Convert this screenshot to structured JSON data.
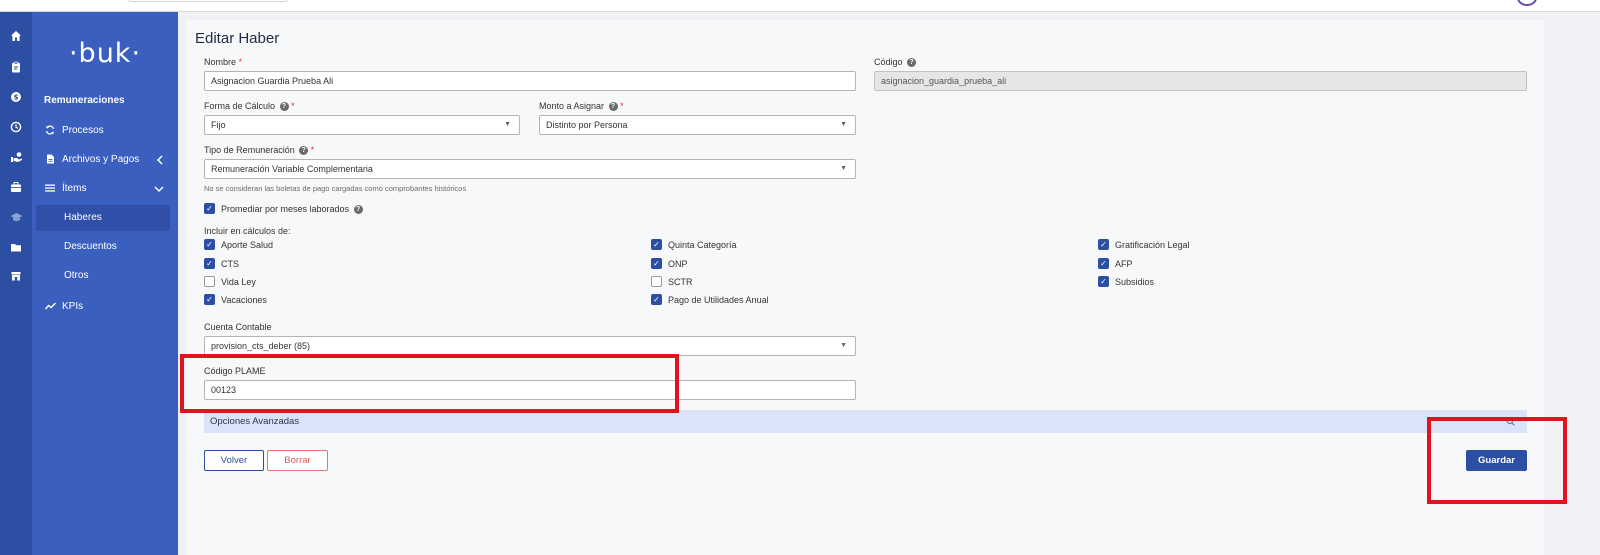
{
  "brand": {
    "logo_text": "·buk·"
  },
  "rail": {
    "icons": [
      "home-icon",
      "clipboard-icon",
      "coin-icon",
      "clock-icon",
      "hand-money-icon",
      "briefcase-icon",
      "graduation-cap-icon",
      "folder-icon",
      "store-icon"
    ],
    "active": "coin-icon"
  },
  "sidebar": {
    "section_title": "Remuneraciones",
    "items": {
      "procesos": {
        "label": "Procesos"
      },
      "archivos": {
        "label": "Archivos y Pagos"
      },
      "items": {
        "label": "Ítems"
      },
      "kpis": {
        "label": "KPIs"
      }
    },
    "subitems": {
      "haberes": {
        "label": "Haberes",
        "active": true
      },
      "descuentos": {
        "label": "Descuentos"
      },
      "otros": {
        "label": "Otros"
      }
    }
  },
  "form": {
    "title": "Editar Haber",
    "nombre": {
      "label": "Nombre",
      "value": "Asignacion Guardia Prueba Ali"
    },
    "codigo": {
      "label": "Código",
      "value": "asignacion_guardia_prueba_ali"
    },
    "forma_calculo": {
      "label": "Forma de Cálculo",
      "value": "Fijo"
    },
    "monto_asignar": {
      "label": "Monto a Asignar",
      "value": "Distinto por Persona"
    },
    "tipo_remuneracion": {
      "label": "Tipo de Remuneración",
      "value": "Remuneración Variable Complementaria",
      "hint": "No se consideran las boletas de pago cargadas como comprobantes históricos"
    },
    "promediar": {
      "label": "Promediar por meses laborados",
      "checked": true
    },
    "incluir_label": "Incluir en cálculos de:",
    "checks": {
      "aporte_salud": {
        "label": "Aporte Salud",
        "checked": true
      },
      "cts": {
        "label": "CTS",
        "checked": true
      },
      "vida_ley": {
        "label": "Vida Ley",
        "checked": false
      },
      "vacaciones": {
        "label": "Vacaciones",
        "checked": true
      },
      "quinta": {
        "label": "Quinta Categoría",
        "checked": true
      },
      "onp": {
        "label": "ONP",
        "checked": true
      },
      "sctr": {
        "label": "SCTR",
        "checked": false
      },
      "utilidades": {
        "label": "Pago de Utilidades Anual",
        "checked": true
      },
      "gratificacion": {
        "label": "Gratificación Legal",
        "checked": true
      },
      "afp": {
        "label": "AFP",
        "checked": true
      },
      "subsidios": {
        "label": "Subsidios",
        "checked": true
      }
    },
    "cuenta_contable": {
      "label": "Cuenta Contable",
      "value": "provision_cts_deber (85)"
    },
    "codigo_plame": {
      "label": "Código PLAME",
      "value": "00123"
    },
    "advanced": {
      "label": "Opciones Avanzadas"
    },
    "buttons": {
      "volver": "Volver",
      "borrar": "Borrar",
      "guardar": "Guardar"
    }
  },
  "symbols": {
    "required": "*",
    "help": "?",
    "check": "✓",
    "caret": "▼"
  },
  "colors": {
    "brand_blue": "#2c4ea3",
    "sidebar": "#3a5fbf",
    "highlight_red": "#e0141e",
    "advanced_bg": "#dbe3f8"
  }
}
